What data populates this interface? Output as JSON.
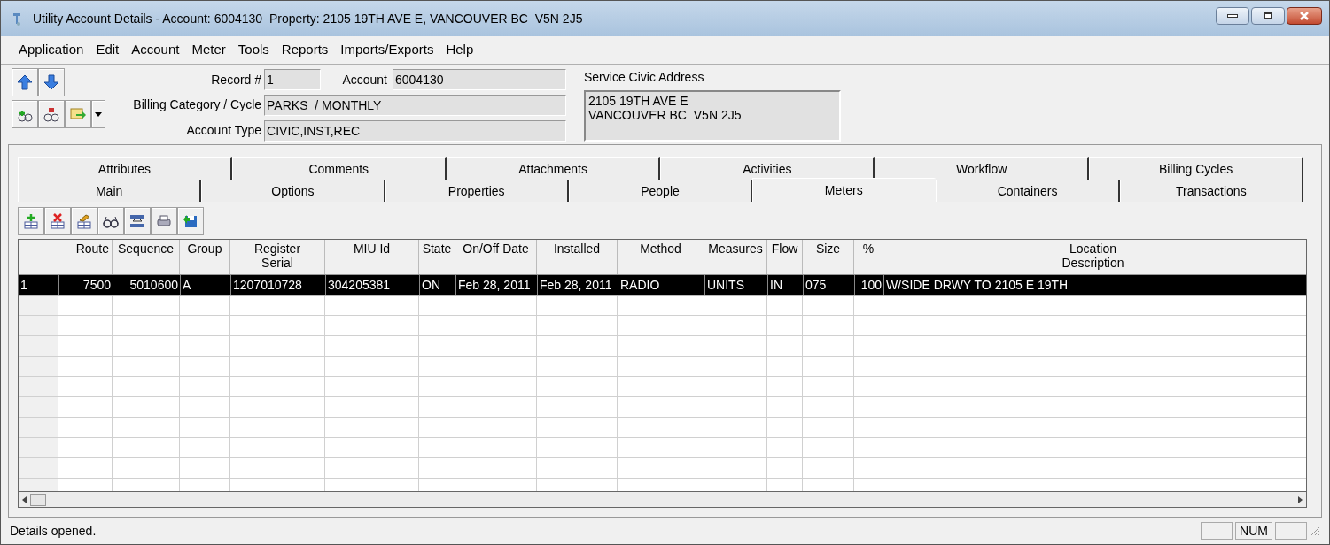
{
  "window": {
    "title": "Utility Account Details - Account: 6004130  Property: 2105 19TH AVE E, VANCOUVER BC  V5N 2J5"
  },
  "menu": [
    "Application",
    "Edit",
    "Account",
    "Meter",
    "Tools",
    "Reports",
    "Imports/Exports",
    "Help"
  ],
  "header": {
    "record_label": "Record #",
    "record": "1",
    "account_label": "Account",
    "account": "6004130",
    "billing_label": "Billing Category / Cycle",
    "billing": "PARKS  / MONTHLY",
    "type_label": "Account Type",
    "type": "CIVIC,INST,REC",
    "address_label": "Service Civic Address",
    "address_lines": [
      "2105 19TH AVE E",
      "VANCOUVER BC  V5N 2J5"
    ]
  },
  "tab_rows": [
    [
      {
        "label": "Attributes",
        "selected": false
      },
      {
        "label": "Comments",
        "selected": false
      },
      {
        "label": "Attachments",
        "selected": false
      },
      {
        "label": "Activities",
        "selected": false
      },
      {
        "label": "Workflow",
        "selected": false
      },
      {
        "label": "Billing Cycles",
        "selected": false
      }
    ],
    [
      {
        "label": "Main",
        "selected": false
      },
      {
        "label": "Options",
        "selected": false
      },
      {
        "label": "Properties",
        "selected": false
      },
      {
        "label": "People",
        "selected": false
      },
      {
        "label": "Meters",
        "selected": true
      },
      {
        "label": "Containers",
        "selected": false
      },
      {
        "label": "Transactions",
        "selected": false
      }
    ]
  ],
  "table": {
    "columns": [
      "Route",
      "Sequence",
      "Group",
      "Register Serial",
      "MIU Id",
      "State",
      "On/Off Date",
      "Installed",
      "Method",
      "Measures",
      "Flow",
      "Size",
      "%",
      "Location Description"
    ],
    "rows": [
      {
        "index": "1",
        "selected": true,
        "cells": [
          "7500",
          "5010600",
          "A",
          "1207010728",
          "304205381",
          "ON",
          "Feb 28, 2011",
          "Feb 28, 2011",
          "RADIO",
          "UNITS",
          "IN",
          "075",
          "100",
          "W/SIDE DRWY TO 2105 E 19TH"
        ]
      }
    ]
  },
  "status_bar": {
    "message": "Details opened.",
    "panels": [
      "NUM"
    ]
  }
}
